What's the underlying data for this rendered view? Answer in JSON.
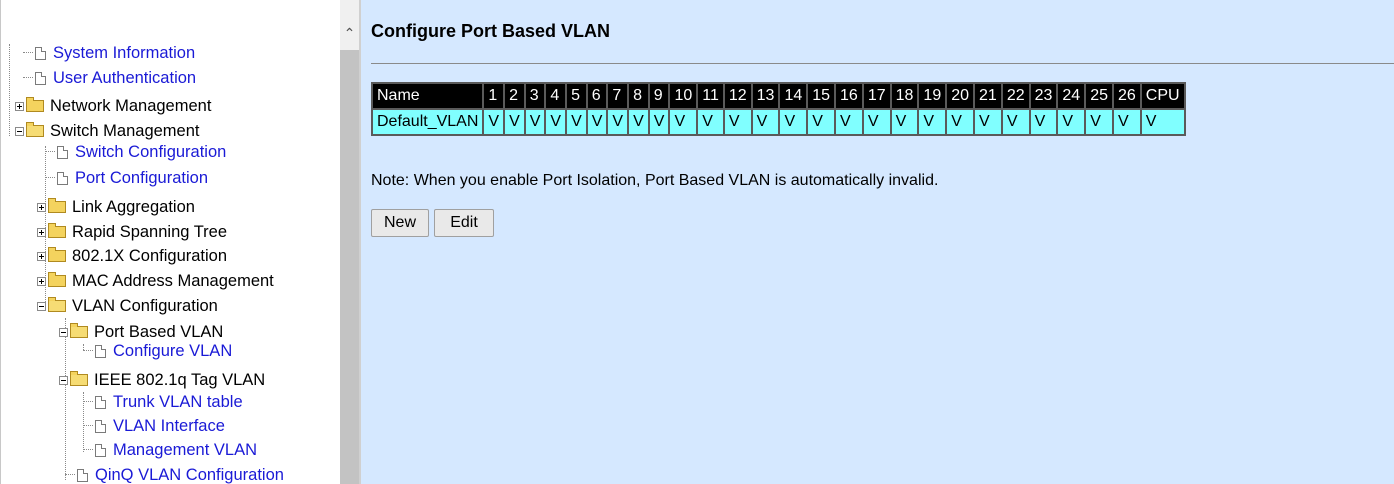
{
  "nav_tree": {
    "system_information": "System Information",
    "user_authentication": "User Authentication",
    "network_management": "Network Management",
    "switch_management": "Switch Management",
    "switch_configuration": "Switch Configuration",
    "port_configuration": "Port Configuration",
    "link_aggregation": "Link Aggregation",
    "rapid_spanning_tree": "Rapid Spanning Tree",
    "dot1x_configuration": "802.1X Configuration",
    "mac_address_management": "MAC Address Management",
    "vlan_configuration": "VLAN Configuration",
    "port_based_vlan": "Port Based VLAN",
    "configure_vlan": "Configure VLAN",
    "ieee_tag_vlan": "IEEE 802.1q Tag VLAN",
    "trunk_vlan_table": "Trunk VLAN table",
    "vlan_interface": "VLAN Interface",
    "management_vlan": "Management VLAN",
    "qinq_vlan_configuration": "QinQ VLAN Configuration"
  },
  "main": {
    "title": "Configure Port Based VLAN",
    "table": {
      "headers": [
        "Name",
        "1",
        "2",
        "3",
        "4",
        "5",
        "6",
        "7",
        "8",
        "9",
        "10",
        "11",
        "12",
        "13",
        "14",
        "15",
        "16",
        "17",
        "18",
        "19",
        "20",
        "21",
        "22",
        "23",
        "24",
        "25",
        "26",
        "CPU"
      ],
      "rows": [
        [
          "Default_VLAN",
          "V",
          "V",
          "V",
          "V",
          "V",
          "V",
          "V",
          "V",
          "V",
          "V",
          "V",
          "V",
          "V",
          "V",
          "V",
          "V",
          "V",
          "V",
          "V",
          "V",
          "V",
          "V",
          "V",
          "V",
          "V",
          "V",
          "V"
        ]
      ]
    },
    "note": "Note: When you enable Port Isolation, Port Based VLAN is automatically invalid.",
    "new_button": "New",
    "edit_button": "Edit"
  },
  "colors": {
    "content_background": "#d5e8ff",
    "table_header": "#000000",
    "table_cell": "#80ffff",
    "link": "#1a1ad6"
  }
}
